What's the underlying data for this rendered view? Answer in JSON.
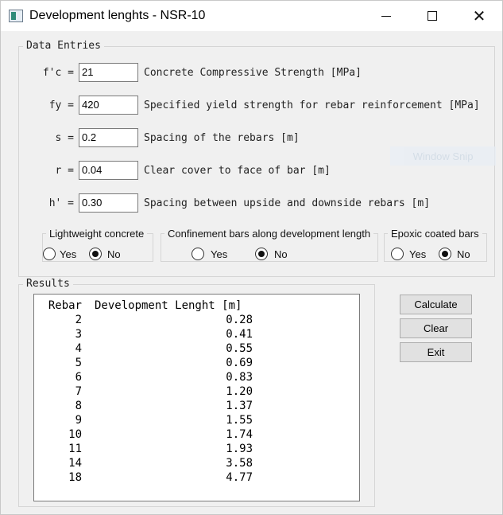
{
  "window": {
    "title": "Development lenghts - NSR-10",
    "min_glyph": "",
    "close_glyph": "✕"
  },
  "data_entries": {
    "legend": "Data Entries",
    "rows": [
      {
        "label": "f'c =",
        "value": "21",
        "desc": "Concrete Compressive Strength [MPa]"
      },
      {
        "label": "fy =",
        "value": "420",
        "desc": "Specified yield strength for rebar reinforcement [MPa]"
      },
      {
        "label": "s =",
        "value": "0.2",
        "desc": "Spacing of the rebars [m]"
      },
      {
        "label": "r =",
        "value": "0.04",
        "desc": "Clear cover to face of bar [m]"
      },
      {
        "label": "h' =",
        "value": "0.30",
        "desc": "Spacing between upside and downside rebars [m]"
      }
    ],
    "groups": [
      {
        "title": "Lightweight concrete",
        "yes": "Yes",
        "no": "No",
        "selected": "No"
      },
      {
        "title": "Confinement bars along development length",
        "yes": "Yes",
        "no": "No",
        "selected": "No"
      },
      {
        "title": "Epoxic coated bars",
        "yes": "Yes",
        "no": "No",
        "selected": "No"
      }
    ]
  },
  "results": {
    "legend": "Results",
    "headers": {
      "rebar": "Rebar",
      "length": "Development Lenght [m]"
    },
    "rows": [
      {
        "rebar": "2",
        "length": "0.28"
      },
      {
        "rebar": "3",
        "length": "0.41"
      },
      {
        "rebar": "4",
        "length": "0.55"
      },
      {
        "rebar": "5",
        "length": "0.69"
      },
      {
        "rebar": "6",
        "length": "0.83"
      },
      {
        "rebar": "7",
        "length": "1.20"
      },
      {
        "rebar": "8",
        "length": "1.37"
      },
      {
        "rebar": "9",
        "length": "1.55"
      },
      {
        "rebar": "10",
        "length": "1.74"
      },
      {
        "rebar": "11",
        "length": "1.93"
      },
      {
        "rebar": "14",
        "length": "3.58"
      },
      {
        "rebar": "18",
        "length": "4.77"
      }
    ]
  },
  "buttons": {
    "calculate": "Calculate",
    "clear": "Clear",
    "exit": "Exit"
  },
  "overlay": {
    "window_snip": "Window Snip"
  }
}
